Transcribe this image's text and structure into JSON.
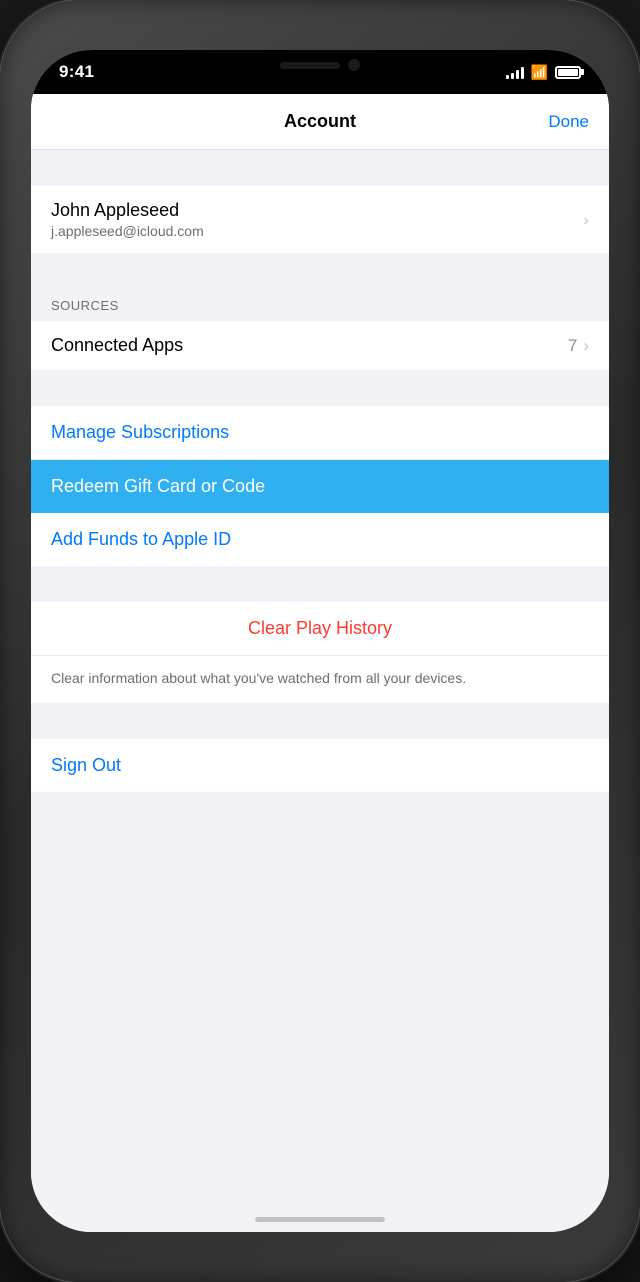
{
  "phone": {
    "status": {
      "time": "9:41",
      "signal_bars": [
        4,
        6,
        8,
        10,
        12
      ],
      "wifi": "wifi",
      "battery": "battery"
    }
  },
  "nav": {
    "title": "Account",
    "done_label": "Done"
  },
  "profile": {
    "name": "John Appleseed",
    "email": "j.appleseed@icloud.com",
    "badge": "",
    "chevron": "›"
  },
  "sources": {
    "header": "SOURCES",
    "connected_apps_label": "Connected Apps",
    "connected_apps_count": "7",
    "chevron": "›"
  },
  "actions": {
    "manage_subscriptions": "Manage Subscriptions",
    "redeem_gift_card": "Redeem Gift Card or Code",
    "add_funds": "Add Funds to Apple ID"
  },
  "danger": {
    "clear_history_label": "Clear Play History",
    "clear_history_description": "Clear information about what you've watched from all your devices."
  },
  "sign_out": {
    "label": "Sign Out"
  }
}
